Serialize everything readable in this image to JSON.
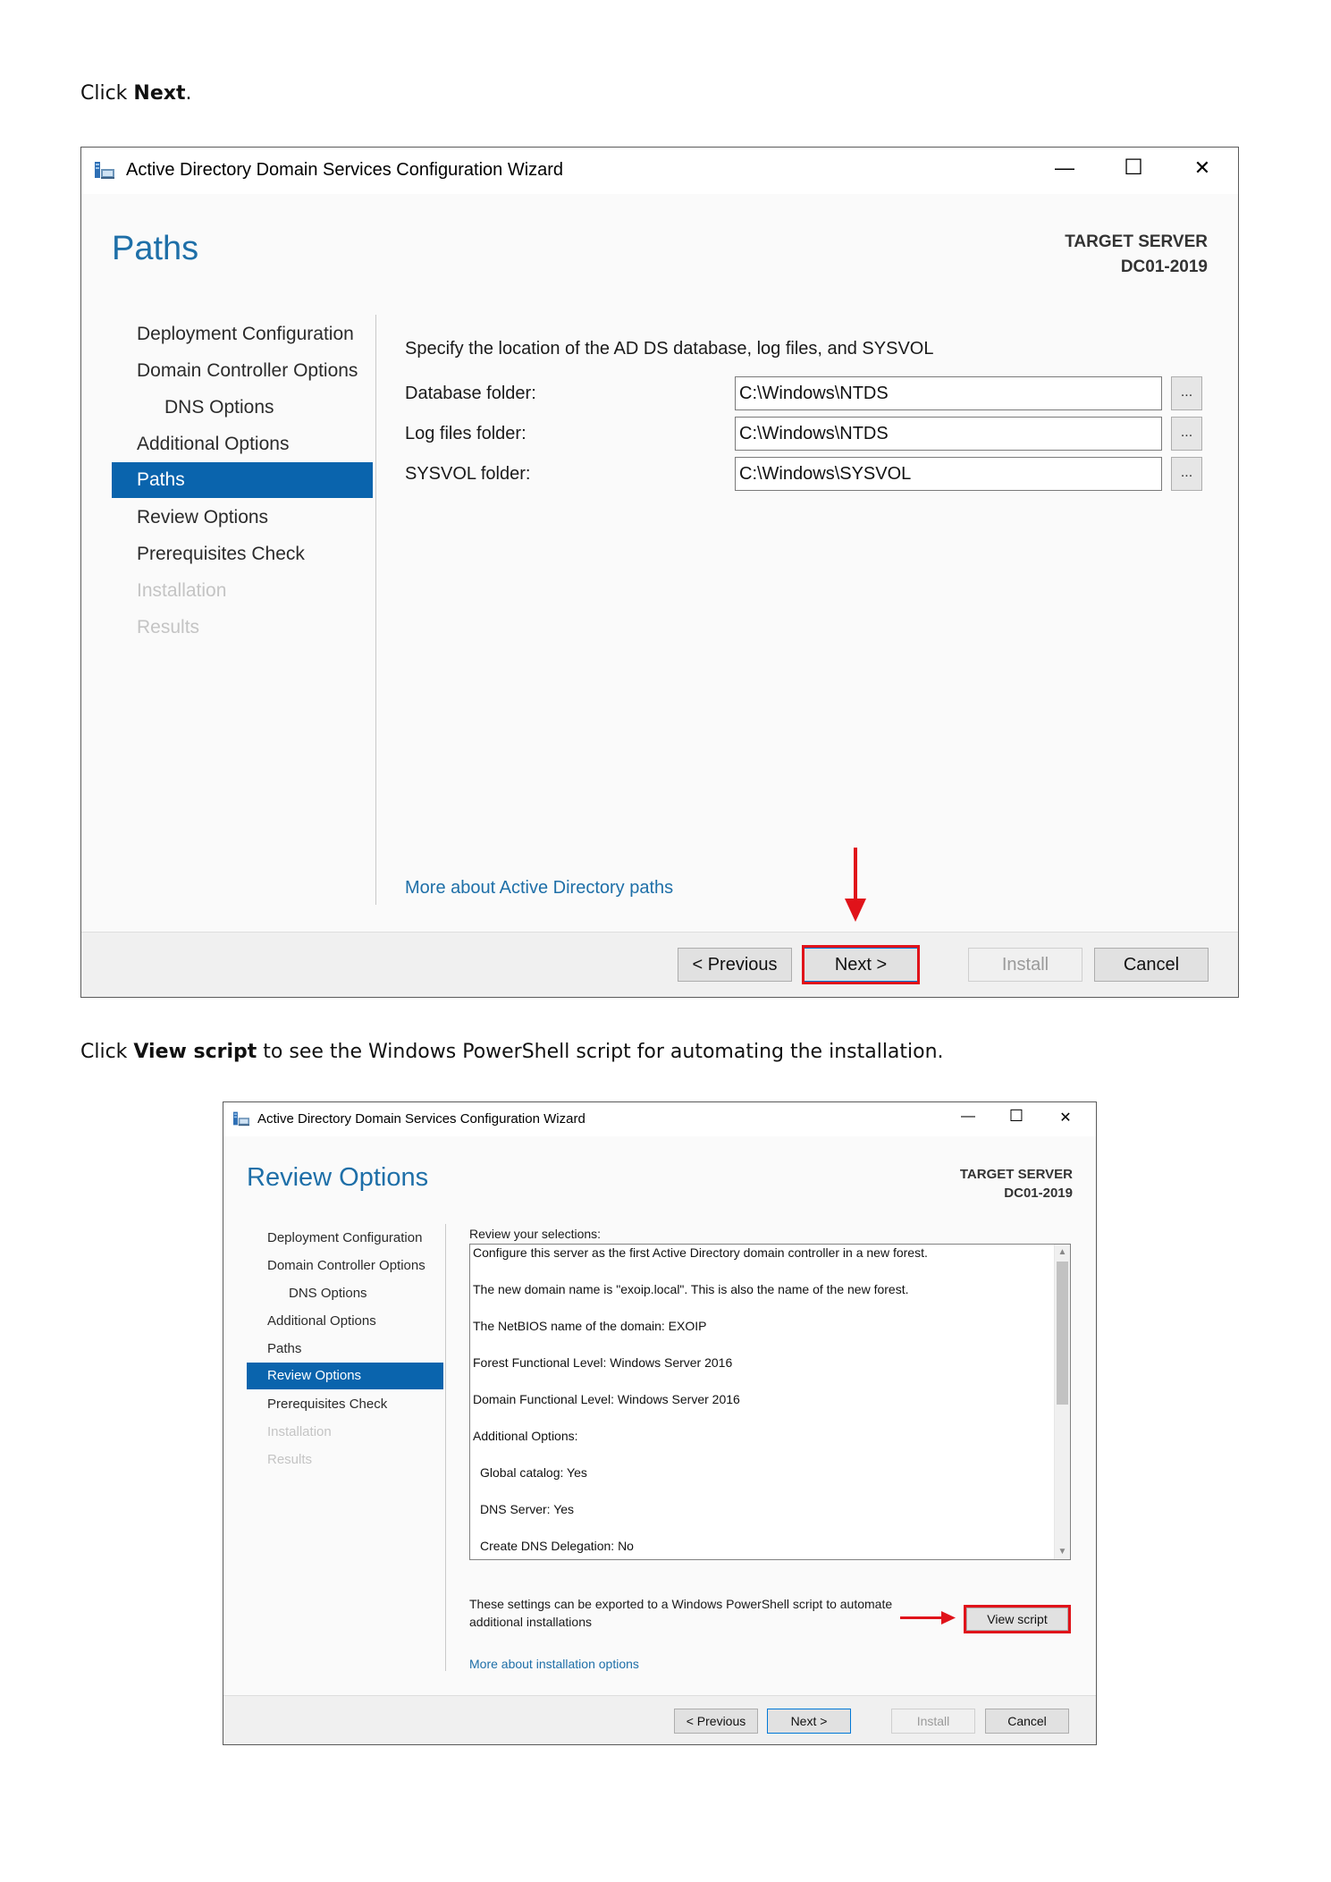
{
  "instruction1": {
    "prefix": "Click ",
    "bold": "Next",
    "suffix": "."
  },
  "instruction2": {
    "prefix": "Click ",
    "bold": "View script",
    "suffix": " to see the Windows PowerShell script for automating the installation."
  },
  "wizard1": {
    "window_title": "Active Directory Domain Services Configuration Wizard",
    "controls": {
      "minimize": "—",
      "maximize": "☐",
      "close": "✕"
    },
    "page_title": "Paths",
    "target_server_label": "TARGET SERVER",
    "target_server_name": "DC01-2019",
    "nav": [
      {
        "label": "Deployment Configuration",
        "state": "normal"
      },
      {
        "label": "Domain Controller Options",
        "state": "normal"
      },
      {
        "label": "DNS Options",
        "state": "normal"
      },
      {
        "label": "Additional Options",
        "state": "normal"
      },
      {
        "label": "Paths",
        "state": "active"
      },
      {
        "label": "Review Options",
        "state": "normal"
      },
      {
        "label": "Prerequisites Check",
        "state": "normal"
      },
      {
        "label": "Installation",
        "state": "disabled"
      },
      {
        "label": "Results",
        "state": "disabled"
      }
    ],
    "heading": "Specify the location of the AD DS database, log files, and SYSVOL",
    "fields": [
      {
        "label": "Database folder:",
        "value": "C:\\Windows\\NTDS"
      },
      {
        "label": "Log files folder:",
        "value": "C:\\Windows\\NTDS"
      },
      {
        "label": "SYSVOL folder:",
        "value": "C:\\Windows\\SYSVOL"
      }
    ],
    "browse_label": "...",
    "more_link": "More about Active Directory paths",
    "buttons": {
      "previous": "< Previous",
      "next": "Next >",
      "install": "Install",
      "cancel": "Cancel"
    }
  },
  "wizard2": {
    "window_title": "Active Directory Domain Services Configuration Wizard",
    "controls": {
      "minimize": "—",
      "maximize": "☐",
      "close": "✕"
    },
    "page_title": "Review Options",
    "target_server_label": "TARGET SERVER",
    "target_server_name": "DC01-2019",
    "nav": [
      {
        "label": "Deployment Configuration",
        "state": "normal"
      },
      {
        "label": "Domain Controller Options",
        "state": "normal"
      },
      {
        "label": "DNS Options",
        "state": "normal"
      },
      {
        "label": "Additional Options",
        "state": "normal"
      },
      {
        "label": "Paths",
        "state": "normal"
      },
      {
        "label": "Review Options",
        "state": "active"
      },
      {
        "label": "Prerequisites Check",
        "state": "normal"
      },
      {
        "label": "Installation",
        "state": "disabled"
      },
      {
        "label": "Results",
        "state": "disabled"
      }
    ],
    "review_heading": "Review your selections:",
    "review_lines": [
      "Configure this server as the first Active Directory domain controller in a new forest.",
      "The new domain name is \"exoip.local\". This is also the name of the new forest.",
      "The NetBIOS name of the domain: EXOIP",
      "Forest Functional Level: Windows Server 2016",
      "Domain Functional Level: Windows Server 2016",
      "Additional Options:",
      "Global catalog: Yes",
      "DNS Server: Yes",
      "Create DNS Delegation: No"
    ],
    "export_note_line1": "These settings can be exported to a Windows PowerShell script to automate",
    "export_note_line2": "additional installations",
    "view_script": "View script",
    "more_link": "More about installation options",
    "buttons": {
      "previous": "< Previous",
      "next": "Next >",
      "install": "Install",
      "cancel": "Cancel"
    }
  }
}
